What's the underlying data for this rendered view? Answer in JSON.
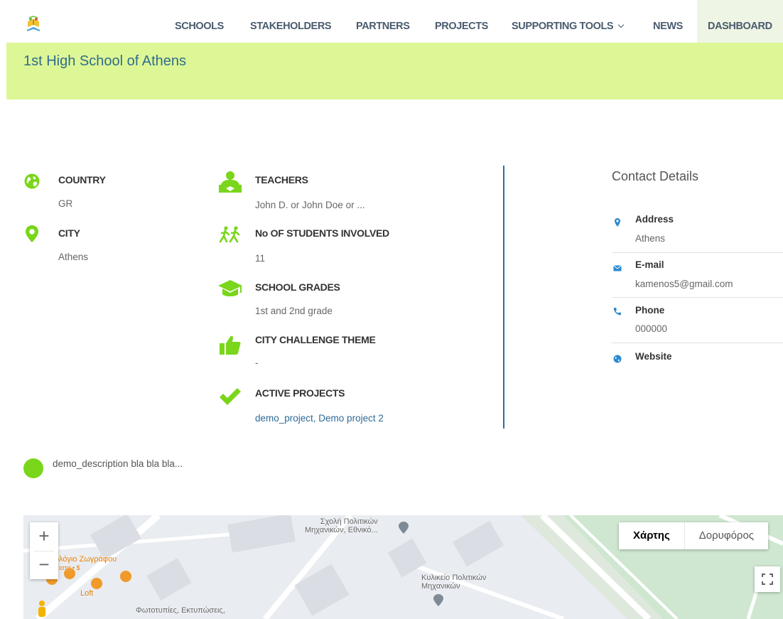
{
  "nav": {
    "items": [
      {
        "label": "SCHOOLS"
      },
      {
        "label": "STAKEHOLDERS"
      },
      {
        "label": "PARTNERS"
      },
      {
        "label": "PROJECTS"
      },
      {
        "label": "SUPPORTING TOOLS"
      },
      {
        "label": "NEWS"
      },
      {
        "label": "DASHBOARD",
        "active": true
      }
    ]
  },
  "banner": {
    "title": "1st High School of Athens"
  },
  "info": {
    "country": {
      "label": "COUNTRY",
      "value": "GR"
    },
    "city": {
      "label": "CITY",
      "value": "Athens"
    },
    "teachers": {
      "label": "TEACHERS",
      "value": "John D. or John Doe or ..."
    },
    "students": {
      "label": "No OF STUDENTS INVOLVED",
      "value": "11"
    },
    "grades": {
      "label": "SCHOOL GRADES",
      "value": "1st and 2nd grade"
    },
    "theme": {
      "label": "CITY CHALLENGE THEME",
      "value": "-"
    },
    "projects": {
      "label": "ACTIVE PROJECTS",
      "value": "demo_project, Demo project 2"
    }
  },
  "contact": {
    "title": "Contact Details",
    "address": {
      "label": "Address",
      "value": "Athens"
    },
    "email": {
      "label": "E-mail",
      "value": "kamenos5@gmail.com"
    },
    "phone": {
      "label": "Phone",
      "value": "000000"
    },
    "website": {
      "label": "Website"
    }
  },
  "description": "demo_description bla bla bla...",
  "map": {
    "zoom_in": "+",
    "zoom_out": "−",
    "type_map": "Χάρτης",
    "type_satellite": "Δορυφόρος",
    "labels": {
      "school": "Σχολή Πολιτικών\nΜηχανικών, Εθνικό...",
      "canteen": "Κυλικείο Πολιτικών\nΜηχανικών",
      "cafe": "ολόγιο Ζωγράφου",
      "cafe_sub": "πιστα • $",
      "loft": "Loft",
      "copies": "Φωτοτυπίες, Εκτυπώσεις,"
    }
  },
  "colors": {
    "accent_green": "#79d61a",
    "banner": "#def796",
    "link_blue": "#2c6a96"
  }
}
